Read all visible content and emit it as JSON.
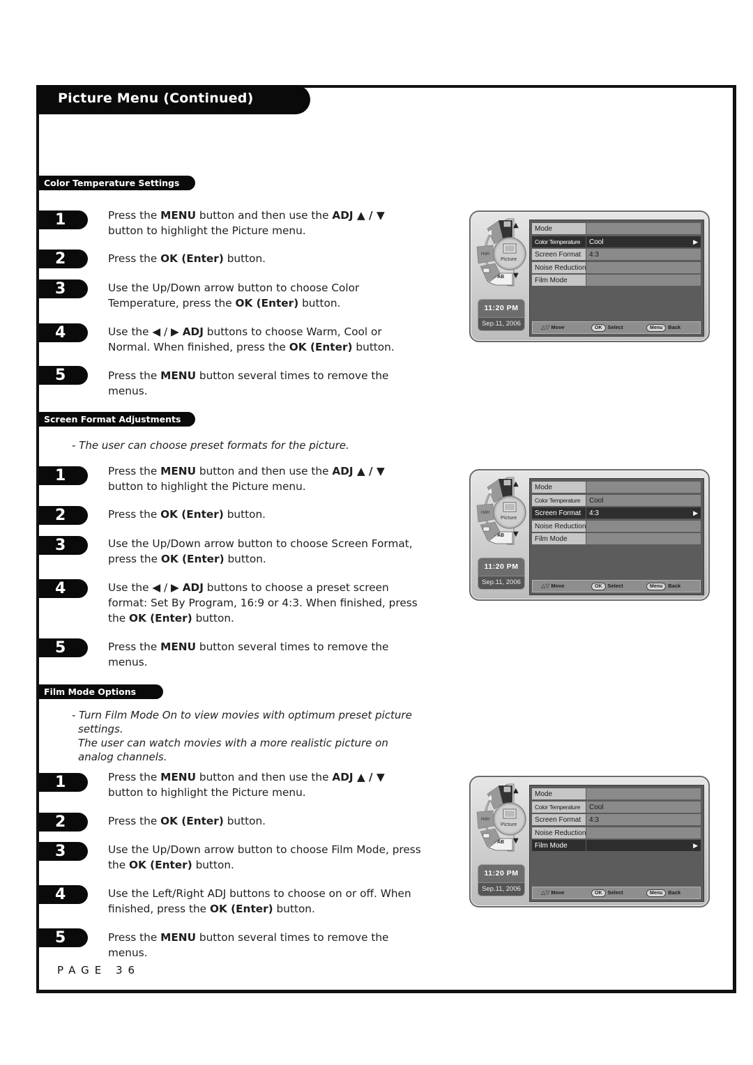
{
  "page": {
    "title": "Picture Menu (Continued)",
    "page_label": "PAGE 36"
  },
  "sections": [
    {
      "heading": "Color Temperature Settings",
      "notes": [],
      "steps": [
        {
          "num": "1",
          "html": "Press the <b>MENU</b> button and then use the <b>ADJ ▲ / ▼</b> button to highlight the Picture menu."
        },
        {
          "num": "2",
          "html": "Press the <b>OK (Enter)</b> button."
        },
        {
          "num": "3",
          "html": "Use the Up/Down arrow button to choose Color Temperature, press the <b>OK (Enter)</b> button."
        },
        {
          "num": "4",
          "html": "Use the ◀ / ▶ <b>ADJ</b> buttons to choose Warm, Cool or Normal. When finished, press the <b>OK (Enter)</b> button."
        },
        {
          "num": "5",
          "html": "Press the <b>MENU</b> button several times to remove the menus."
        }
      ]
    },
    {
      "heading": "Screen Format Adjustments",
      "notes": [
        "- The user can choose preset formats for the picture."
      ],
      "steps": [
        {
          "num": "1",
          "html": "Press the <b>MENU</b> button and then use the <b>ADJ ▲ / ▼</b> button to highlight the Picture menu."
        },
        {
          "num": "2",
          "html": "Press the <b>OK (Enter)</b> button."
        },
        {
          "num": "3",
          "html": "Use the Up/Down arrow button to choose Screen Format, press the <b>OK (Enter)</b> button."
        },
        {
          "num": "4",
          "html": "Use the ◀ / ▶ <b>ADJ</b> buttons to choose a preset screen format: Set By Program, 16:9 or 4:3. When finished, press the <b>OK (Enter)</b> button."
        },
        {
          "num": "5",
          "html": "Press the <b>MENU</b> button several times to remove the menus."
        }
      ]
    },
    {
      "heading": "Film Mode Options",
      "notes": [
        "- Turn Film Mode On to view movies with optimum preset picture settings.",
        "The user can watch movies with a more realistic picture on analog channels."
      ],
      "steps": [
        {
          "num": "1",
          "html": "Press the <b>MENU</b> button and then use the <b>ADJ ▲ / ▼</b> button to highlight the Picture menu."
        },
        {
          "num": "2",
          "html": "Press the <b>OK (Enter)</b> button."
        },
        {
          "num": "3",
          "html": "Use the Up/Down arrow button to choose Film Mode, press the <b>OK (Enter)</b> button."
        },
        {
          "num": "4",
          "html": "Use the Left/Right ADJ buttons to choose on or off. When finished, press the <b>OK (Enter)</b> button."
        },
        {
          "num": "5",
          "html": "Press the <b>MENU</b> button several times to remove the menus."
        }
      ]
    }
  ],
  "osd_common": {
    "wheel_center_label": "Picture",
    "wheel_icons": [
      "picture-icon",
      "speaker-icon",
      "antenna-icon",
      "lock-icon",
      "language-icon"
    ],
    "wheel_ab_label": "AB",
    "time": "11:20 PM",
    "date": "Sep.11, 2006",
    "footer": {
      "move_label": "Move",
      "ok_key": "OK",
      "select_label": "Select",
      "menu_key": "Menu",
      "back_label": "Back"
    }
  },
  "osd_screens": [
    {
      "rows": [
        {
          "label": "Mode",
          "value": ""
        },
        {
          "label": "Color Temperature",
          "value": "Cool",
          "selected": true
        },
        {
          "label": "Screen Format",
          "value": "4:3"
        },
        {
          "label": "Noise Reduction",
          "value": ""
        },
        {
          "label": "Film Mode",
          "value": ""
        }
      ]
    },
    {
      "rows": [
        {
          "label": "Mode",
          "value": ""
        },
        {
          "label": "Color Temperature",
          "value": "Cool"
        },
        {
          "label": "Screen Format",
          "value": "4:3",
          "selected": true
        },
        {
          "label": "Noise Reduction",
          "value": ""
        },
        {
          "label": "Film Mode",
          "value": ""
        }
      ]
    },
    {
      "rows": [
        {
          "label": "Mode",
          "value": ""
        },
        {
          "label": "Color Temperature",
          "value": "Cool"
        },
        {
          "label": "Screen Format",
          "value": "4:3"
        },
        {
          "label": "Noise Reduction",
          "value": ""
        },
        {
          "label": "Film Mode",
          "value": "",
          "selected": true
        }
      ]
    }
  ]
}
